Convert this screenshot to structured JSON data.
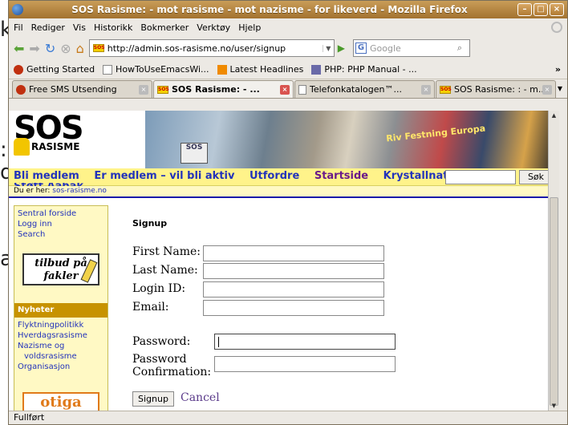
{
  "window": {
    "title": "SOS Rasisme: - mot rasisme - mot nazisme - for likeverd - Mozilla Firefox"
  },
  "menu": [
    "Fil",
    "Rediger",
    "Vis",
    "Historikk",
    "Bokmerker",
    "Verktøy",
    "Hjelp"
  ],
  "url": "http://admin.sos-rasisme.no/user/signup",
  "search_placeholder": "Google",
  "bookmarks": [
    "Getting Started",
    "HowToUseEmacsWi...",
    "Latest Headlines",
    "PHP: PHP Manual - ..."
  ],
  "bookmarks_more": "»",
  "tabs": [
    "Free SMS Utsending",
    "SOS Rasisme: - ...",
    "Telefonkatalogen™...",
    "SOS Rasisme: : - m..."
  ],
  "site": {
    "logo_top": "SOS",
    "logo_bottom": "RASISME",
    "photo_sign": "SOS",
    "photo_banner": "Riv Festning Europa",
    "nav": [
      "Bli medlem",
      "Er medlem – vil bli aktiv",
      "Utfordre",
      "Startside",
      "Krystallnatta"
    ],
    "nav_cut": "Støtt Aabak",
    "search_button": "Søk",
    "breadcrumb_label": "Du er her:",
    "breadcrumb_link": "sos-rasisme.no"
  },
  "sidebar": {
    "links": [
      "Sentral forside",
      "Logg inn",
      "Search"
    ],
    "badge_line1": "tilbud på",
    "badge_line2": "fakler",
    "news_header": "Nyheter",
    "news": [
      "Flyktningpolitikk",
      "Hverdagsrasisme",
      "Nazisme og",
      "voldsrasisme",
      "Organisasjon"
    ],
    "promo": "otiga"
  },
  "form": {
    "heading": "Signup",
    "first_name": "First Name:",
    "last_name": "Last Name:",
    "login_id": "Login ID:",
    "email": "Email:",
    "password": "Password:",
    "password_confirm_1": "Password",
    "password_confirm_2": "Confirmation:",
    "submit": "Signup",
    "cancel": "Cancel"
  },
  "status": "Fullført",
  "desktop_fragments": [
    "k",
    ":",
    "d",
    "a"
  ]
}
